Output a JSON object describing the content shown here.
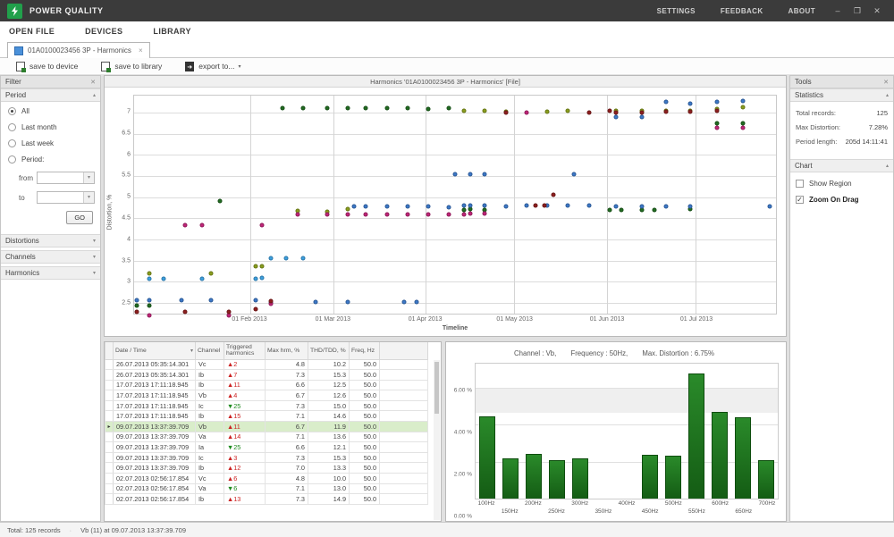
{
  "titlebar": {
    "app_title": "POWER QUALITY",
    "right_items": [
      "SETTINGS",
      "FEEDBACK",
      "ABOUT"
    ],
    "window_buttons": {
      "minimize": "–",
      "restore": "❐",
      "close": "✕"
    },
    "brand_color": "#21a04b"
  },
  "menubar": {
    "items": [
      "OPEN FILE",
      "DEVICES",
      "LIBRARY"
    ]
  },
  "tab": {
    "label": "01A0100023456 3P - Harmonics",
    "close": "×"
  },
  "toolbar": {
    "save_to_device": "save to device",
    "save_to_library": "save to library",
    "export_to": "export to...",
    "export_caret": "▾"
  },
  "filter_panel": {
    "title": "Filter",
    "close": "✕",
    "period": {
      "title": "Period",
      "chevron": "▴",
      "options": [
        {
          "label": "All",
          "selected": true
        },
        {
          "label": "Last month",
          "selected": false
        },
        {
          "label": "Last week",
          "selected": false
        },
        {
          "label": "Period:",
          "selected": false
        }
      ],
      "from_label": "from",
      "to_label": "to",
      "from_value": "",
      "to_value": "",
      "go_label": "GO"
    },
    "collapsed_sections": [
      "Distortions",
      "Channels",
      "Harmonics"
    ]
  },
  "tools_panel": {
    "title": "Tools",
    "close": "✕",
    "statistics": {
      "title": "Statistics",
      "chevron": "▴",
      "rows": [
        {
          "label": "Total records:",
          "value": "125"
        },
        {
          "label": "Max Distortion:",
          "value": "7.28%"
        },
        {
          "label": "Period length:",
          "value": "205d 14:11:41"
        }
      ]
    },
    "chart": {
      "title": "Chart",
      "chevron": "▴",
      "checkboxes": [
        {
          "label": "Show Region",
          "checked": false,
          "bold": false
        },
        {
          "label": "Zoom On Drag",
          "checked": true,
          "bold": true
        }
      ]
    }
  },
  "chart_panel": {
    "title": "Harmonics '01A0100023456 3P - Harmonics' [File]"
  },
  "table": {
    "columns": [
      "Date / Time",
      "Channel",
      "Triggered harmonics",
      "Max hrm, %",
      "THD/TDD, %",
      "Freq, Hz"
    ],
    "sort_indicator": "▾",
    "selected_index": 6,
    "rows": [
      {
        "datetime": "26.07.2013 05:35:14.301",
        "channel": "Vc",
        "trig_dir": "up",
        "trig": "2",
        "max_hrm": "4.8",
        "thd": "10.2",
        "freq": "50.0"
      },
      {
        "datetime": "26.07.2013 05:35:14.301",
        "channel": "Ib",
        "trig_dir": "up",
        "trig": "7",
        "max_hrm": "7.3",
        "thd": "15.3",
        "freq": "50.0"
      },
      {
        "datetime": "17.07.2013 17:11:18.945",
        "channel": "Ib",
        "trig_dir": "up",
        "trig": "11",
        "max_hrm": "6.6",
        "thd": "12.5",
        "freq": "50.0"
      },
      {
        "datetime": "17.07.2013 17:11:18.945",
        "channel": "Vb",
        "trig_dir": "up",
        "trig": "4",
        "max_hrm": "6.7",
        "thd": "12.6",
        "freq": "50.0"
      },
      {
        "datetime": "17.07.2013 17:11:18.945",
        "channel": "Ic",
        "trig_dir": "down",
        "trig": "25",
        "max_hrm": "7.3",
        "thd": "15.0",
        "freq": "50.0"
      },
      {
        "datetime": "17.07.2013 17:11:18.945",
        "channel": "Ib",
        "trig_dir": "up",
        "trig": "15",
        "max_hrm": "7.1",
        "thd": "14.6",
        "freq": "50.0"
      },
      {
        "datetime": "09.07.2013 13:37:39.709",
        "channel": "Vb",
        "trig_dir": "up",
        "trig": "11",
        "max_hrm": "6.7",
        "thd": "11.9",
        "freq": "50.0"
      },
      {
        "datetime": "09.07.2013 13:37:39.709",
        "channel": "Va",
        "trig_dir": "up",
        "trig": "14",
        "max_hrm": "7.1",
        "thd": "13.6",
        "freq": "50.0"
      },
      {
        "datetime": "09.07.2013 13:37:39.709",
        "channel": "Ia",
        "trig_dir": "down",
        "trig": "25",
        "max_hrm": "6.6",
        "thd": "12.1",
        "freq": "50.0"
      },
      {
        "datetime": "09.07.2013 13:37:39.709",
        "channel": "Ic",
        "trig_dir": "up",
        "trig": "3",
        "max_hrm": "7.3",
        "thd": "15.3",
        "freq": "50.0"
      },
      {
        "datetime": "09.07.2013 13:37:39.709",
        "channel": "Ib",
        "trig_dir": "up",
        "trig": "12",
        "max_hrm": "7.0",
        "thd": "13.3",
        "freq": "50.0"
      },
      {
        "datetime": "02.07.2013 02:56:17.854",
        "channel": "Vc",
        "trig_dir": "up",
        "trig": "6",
        "max_hrm": "4.8",
        "thd": "10.0",
        "freq": "50.0"
      },
      {
        "datetime": "02.07.2013 02:56:17.854",
        "channel": "Va",
        "trig_dir": "down",
        "trig": "6",
        "max_hrm": "7.1",
        "thd": "13.0",
        "freq": "50.0"
      },
      {
        "datetime": "02.07.2013 02:56:17.854",
        "channel": "Ib",
        "trig_dir": "up",
        "trig": "13",
        "max_hrm": "7.3",
        "thd": "14.9",
        "freq": "50.0"
      }
    ]
  },
  "detail_header": {
    "channel": "Channel : Vb,",
    "frequency": "Frequency : 50Hz,",
    "distortion": "Max. Distortion : 6.75%"
  },
  "statusbar": {
    "total": "Total: 125 records",
    "selection": "Vb (11) at 09.07.2013 13:37:39.709"
  },
  "chart_data": [
    {
      "type": "scatter",
      "title": "Harmonics '01A0100023456 3P - Harmonics' [File]",
      "xlabel": "Timeline",
      "ylabel": "Distortion, %",
      "x_domain": [
        "2012-12-24",
        "2013-07-28"
      ],
      "y_min": 2.25,
      "y_max": 7.4,
      "y_ticks": [
        2.5,
        3,
        3.5,
        4,
        4.5,
        5,
        5.5,
        6,
        6.5,
        7
      ],
      "x_ticks": [
        "2013-02-01",
        "2013-03-01",
        "2013-04-01",
        "2013-05-01",
        "2013-06-01",
        "2013-07-01"
      ],
      "x_tick_labels": [
        "01 Feb 2013",
        "01 Mar 2013",
        "01 Apr 2013",
        "01 May 2013",
        "01 Jun 2013",
        "01 Jul 2013"
      ],
      "grid": true,
      "series_colors": {
        "Va": "#8a9e1e",
        "Vb": "#3c78c8",
        "Vc": "#3da0e0",
        "Ia": "#c02578",
        "Ib": "#226b22",
        "Ic": "#8e1f1f"
      },
      "points": [
        [
          "2012-12-25",
          2.45,
          "Ib"
        ],
        [
          "2012-12-29",
          2.45,
          "Ib"
        ],
        [
          "2013-02-12",
          7.1,
          "Ib"
        ],
        [
          "2013-02-19",
          7.1,
          "Ib"
        ],
        [
          "2013-02-27",
          7.1,
          "Ib"
        ],
        [
          "2013-03-06",
          7.1,
          "Ib"
        ],
        [
          "2013-03-12",
          7.1,
          "Ib"
        ],
        [
          "2013-03-19",
          7.1,
          "Ib"
        ],
        [
          "2013-03-26",
          7.1,
          "Ib"
        ],
        [
          "2013-04-02",
          7.08,
          "Ib"
        ],
        [
          "2013-04-09",
          7.1,
          "Ib"
        ],
        [
          "2013-01-22",
          4.9,
          "Ib"
        ],
        [
          "2013-04-14",
          4.7,
          "Ib"
        ],
        [
          "2013-04-16",
          4.72,
          "Ib"
        ],
        [
          "2013-04-21",
          4.7,
          "Ib"
        ],
        [
          "2013-06-02",
          4.7,
          "Ib"
        ],
        [
          "2013-06-06",
          4.7,
          "Ib"
        ],
        [
          "2013-06-13",
          4.7,
          "Ib"
        ],
        [
          "2013-06-17",
          4.7,
          "Ib"
        ],
        [
          "2013-06-29",
          4.72,
          "Ib"
        ],
        [
          "2013-07-08",
          6.75,
          "Ib"
        ],
        [
          "2013-07-17",
          6.75,
          "Ib"
        ],
        [
          "2012-12-29",
          3.2,
          "Va"
        ],
        [
          "2013-01-19",
          3.2,
          "Va"
        ],
        [
          "2013-02-03",
          3.37,
          "Va"
        ],
        [
          "2013-02-05",
          3.37,
          "Va"
        ],
        [
          "2013-02-17",
          4.68,
          "Va"
        ],
        [
          "2013-02-27",
          4.66,
          "Va"
        ],
        [
          "2013-03-06",
          4.72,
          "Va"
        ],
        [
          "2013-04-14",
          7.05,
          "Va"
        ],
        [
          "2013-04-21",
          7.05,
          "Va"
        ],
        [
          "2013-04-28",
          7.03,
          "Va"
        ],
        [
          "2013-05-12",
          7.03,
          "Va"
        ],
        [
          "2013-05-19",
          7.05,
          "Va"
        ],
        [
          "2013-06-04",
          7.05,
          "Va"
        ],
        [
          "2013-06-13",
          7.05,
          "Va"
        ],
        [
          "2013-06-21",
          7.05,
          "Va"
        ],
        [
          "2013-06-29",
          7.05,
          "Va"
        ],
        [
          "2013-07-08",
          7.08,
          "Va"
        ],
        [
          "2013-07-17",
          7.12,
          "Va"
        ],
        [
          "2012-12-25",
          2.57,
          "Vb"
        ],
        [
          "2012-12-29",
          2.57,
          "Vb"
        ],
        [
          "2013-01-09",
          2.57,
          "Vb"
        ],
        [
          "2013-01-19",
          2.57,
          "Vb"
        ],
        [
          "2013-02-03",
          2.57,
          "Vb"
        ],
        [
          "2013-02-08",
          2.5,
          "Vb"
        ],
        [
          "2013-02-23",
          2.52,
          "Vb"
        ],
        [
          "2013-03-06",
          2.52,
          "Vb"
        ],
        [
          "2013-03-25",
          2.52,
          "Vb"
        ],
        [
          "2013-03-29",
          2.52,
          "Vb"
        ],
        [
          "2013-03-08",
          4.78,
          "Vb"
        ],
        [
          "2013-03-12",
          4.78,
          "Vb"
        ],
        [
          "2013-03-19",
          4.78,
          "Vb"
        ],
        [
          "2013-03-26",
          4.78,
          "Vb"
        ],
        [
          "2013-04-02",
          4.78,
          "Vb"
        ],
        [
          "2013-04-09",
          4.76,
          "Vb"
        ],
        [
          "2013-04-14",
          4.8,
          "Vb"
        ],
        [
          "2013-04-16",
          4.8,
          "Vb"
        ],
        [
          "2013-04-21",
          4.8,
          "Vb"
        ],
        [
          "2013-04-28",
          4.78,
          "Vb"
        ],
        [
          "2013-05-05",
          4.8,
          "Vb"
        ],
        [
          "2013-05-12",
          4.8,
          "Vb"
        ],
        [
          "2013-05-19",
          4.8,
          "Vb"
        ],
        [
          "2013-05-26",
          4.8,
          "Vb"
        ],
        [
          "2013-06-04",
          4.78,
          "Vb"
        ],
        [
          "2013-06-13",
          4.78,
          "Vb"
        ],
        [
          "2013-06-21",
          4.78,
          "Vb"
        ],
        [
          "2013-06-29",
          4.78,
          "Vb"
        ],
        [
          "2013-07-26",
          4.78,
          "Vb"
        ],
        [
          "2013-04-11",
          5.55,
          "Vb"
        ],
        [
          "2013-04-16",
          5.55,
          "Vb"
        ],
        [
          "2013-04-21",
          5.55,
          "Vb"
        ],
        [
          "2013-05-21",
          5.55,
          "Vb"
        ],
        [
          "2013-06-04",
          6.9,
          "Vb"
        ],
        [
          "2013-06-13",
          6.9,
          "Vb"
        ],
        [
          "2013-06-21",
          7.25,
          "Vb"
        ],
        [
          "2013-06-29",
          7.22,
          "Vb"
        ],
        [
          "2013-07-08",
          7.25,
          "Vb"
        ],
        [
          "2013-07-17",
          7.28,
          "Vb"
        ],
        [
          "2012-12-29",
          3.07,
          "Vc"
        ],
        [
          "2013-01-03",
          3.07,
          "Vc"
        ],
        [
          "2013-01-16",
          3.07,
          "Vc"
        ],
        [
          "2013-02-03",
          3.07,
          "Vc"
        ],
        [
          "2013-02-05",
          3.1,
          "Vc"
        ],
        [
          "2013-02-08",
          3.55,
          "Vc"
        ],
        [
          "2013-02-13",
          3.55,
          "Vc"
        ],
        [
          "2013-02-19",
          3.55,
          "Vc"
        ],
        [
          "2012-12-29",
          2.2,
          "Ia"
        ],
        [
          "2013-01-25",
          2.2,
          "Ia"
        ],
        [
          "2013-01-10",
          4.33,
          "Ia"
        ],
        [
          "2013-01-16",
          4.33,
          "Ia"
        ],
        [
          "2013-02-05",
          4.33,
          "Ia"
        ],
        [
          "2013-02-17",
          4.6,
          "Ia"
        ],
        [
          "2013-02-27",
          4.6,
          "Ia"
        ],
        [
          "2013-03-06",
          4.6,
          "Ia"
        ],
        [
          "2013-03-12",
          4.6,
          "Ia"
        ],
        [
          "2013-03-19",
          4.6,
          "Ia"
        ],
        [
          "2013-03-26",
          4.6,
          "Ia"
        ],
        [
          "2013-04-02",
          4.6,
          "Ia"
        ],
        [
          "2013-04-09",
          4.6,
          "Ia"
        ],
        [
          "2013-04-14",
          4.6,
          "Ia"
        ],
        [
          "2013-04-16",
          4.62,
          "Ia"
        ],
        [
          "2013-04-21",
          4.62,
          "Ia"
        ],
        [
          "2013-02-08",
          2.48,
          "Ia"
        ],
        [
          "2013-05-05",
          7.0,
          "Ia"
        ],
        [
          "2013-07-08",
          6.63,
          "Ia"
        ],
        [
          "2013-07-17",
          6.63,
          "Ia"
        ],
        [
          "2012-12-25",
          2.3,
          "Ic"
        ],
        [
          "2013-01-10",
          2.3,
          "Ic"
        ],
        [
          "2013-01-25",
          2.3,
          "Ic"
        ],
        [
          "2013-02-03",
          2.35,
          "Ic"
        ],
        [
          "2013-02-08",
          2.55,
          "Ic"
        ],
        [
          "2013-04-28",
          7.0,
          "Ic"
        ],
        [
          "2013-05-26",
          7.0,
          "Ic"
        ],
        [
          "2013-06-02",
          7.05,
          "Ic"
        ],
        [
          "2013-06-04",
          7.0,
          "Ic"
        ],
        [
          "2013-06-13",
          7.0,
          "Ic"
        ],
        [
          "2013-06-21",
          7.02,
          "Ic"
        ],
        [
          "2013-06-29",
          7.02,
          "Ic"
        ],
        [
          "2013-07-08",
          7.05,
          "Ic"
        ],
        [
          "2013-05-14",
          5.05,
          "Ic"
        ],
        [
          "2013-05-08",
          4.8,
          "Ic"
        ],
        [
          "2013-05-11",
          4.8,
          "Ic"
        ]
      ]
    },
    {
      "type": "bar",
      "title": "Channel : Vb,  Frequency : 50Hz,  Max. Distortion : 6.75%",
      "categories": [
        "100Hz",
        "150Hz",
        "200Hz",
        "250Hz",
        "300Hz",
        "350Hz",
        "400Hz",
        "450Hz",
        "500Hz",
        "550Hz",
        "600Hz",
        "650Hz",
        "700Hz"
      ],
      "values": [
        4.45,
        2.2,
        2.4,
        2.1,
        2.2,
        0,
        0,
        2.35,
        2.3,
        6.75,
        4.7,
        4.4,
        2.1
      ],
      "y_ticks": [
        0,
        2,
        4,
        6
      ],
      "y_tick_labels": [
        "0.00 %",
        "2.00 %",
        "4.00 %",
        "6.00 %"
      ],
      "ylim": [
        0,
        7.3
      ],
      "band": [
        4.65,
        5.95
      ],
      "bar_color": "#1b6e1b"
    }
  ]
}
